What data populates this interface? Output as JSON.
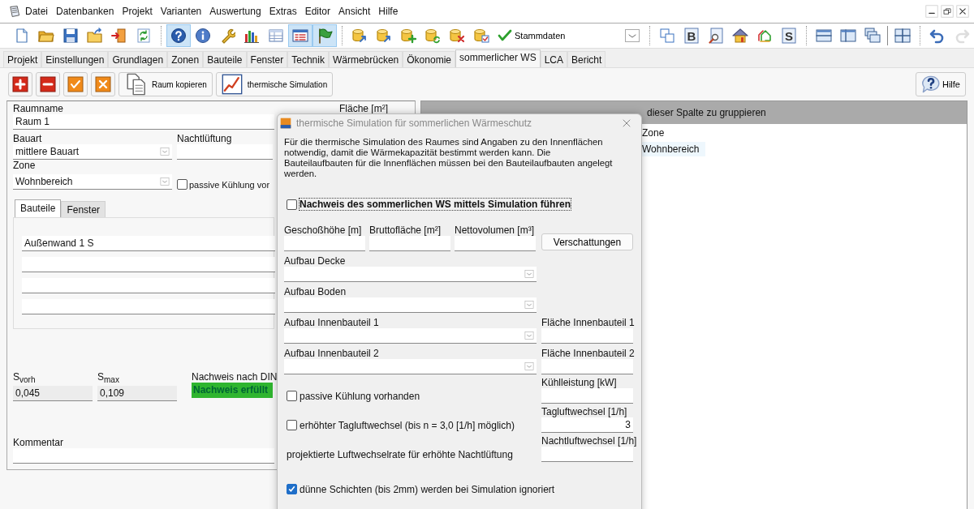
{
  "menu": [
    "Datei",
    "Datenbanken",
    "Projekt",
    "Varianten",
    "Auswertung",
    "Extras",
    "Editor",
    "Ansicht",
    "Hilfe"
  ],
  "toolbar": [
    {
      "pressed": false,
      "disabled": false
    },
    {
      "pressed": false,
      "disabled": false
    },
    {
      "pressed": false,
      "disabled": false
    },
    {
      "pressed": false,
      "disabled": false
    },
    {
      "pressed": false,
      "disabled": false
    },
    {
      "pressed": false,
      "disabled": false
    },
    {
      "pressed": true,
      "disabled": false
    },
    {
      "pressed": false,
      "disabled": false
    },
    {
      "pressed": false,
      "disabled": false
    },
    {
      "pressed": false,
      "disabled": false
    },
    {
      "pressed": false,
      "disabled": false
    },
    {
      "pressed": true,
      "disabled": false
    },
    {
      "pressed": true,
      "disabled": false
    },
    {
      "pressed": false,
      "disabled": false
    },
    {
      "pressed": false,
      "disabled": false
    },
    {
      "pressed": false,
      "disabled": false
    },
    {
      "pressed": false,
      "disabled": false
    },
    {
      "pressed": false,
      "disabled": false
    },
    {
      "pressed": false,
      "disabled": false
    },
    {
      "label": "Stammdaten",
      "pressed": false,
      "disabled": false
    },
    {
      "pressed": false,
      "disabled": false
    },
    {
      "pressed": false,
      "disabled": false
    },
    {
      "glyph": "B",
      "pressed": false,
      "disabled": false
    },
    {
      "pressed": false,
      "disabled": false
    },
    {
      "pressed": false,
      "disabled": false
    },
    {
      "pressed": false,
      "disabled": false
    },
    {
      "glyph": "S",
      "pressed": false,
      "disabled": false
    },
    {
      "pressed": false,
      "disabled": false
    },
    {
      "pressed": false,
      "disabled": false
    },
    {
      "pressed": false,
      "disabled": false
    },
    {
      "pressed": false,
      "disabled": false
    },
    {
      "pressed": false,
      "disabled": false
    },
    {
      "pressed": false,
      "disabled": true
    }
  ],
  "tabs": [
    {
      "label": "Projekt",
      "selected": false
    },
    {
      "label": "Einstellungen",
      "selected": false
    },
    {
      "label": "Grundlagen",
      "selected": false
    },
    {
      "label": "Zonen",
      "selected": false
    },
    {
      "label": "Bauteile",
      "selected": false
    },
    {
      "label": "Fenster",
      "selected": false
    },
    {
      "label": "Technik",
      "selected": false
    },
    {
      "label": "Wärmebrücken",
      "selected": false
    },
    {
      "label": "Ökonomie",
      "selected": false
    },
    {
      "label": "sommerlicher WS",
      "selected": true
    },
    {
      "label": "LCA",
      "selected": false
    },
    {
      "label": "Bericht",
      "selected": false
    }
  ],
  "actions": {
    "copy": "Raum kopieren",
    "simulation": "thermische Simulation",
    "help": "Hilfe"
  },
  "room": {
    "name_label": "Raumname",
    "name": "Raum 1",
    "area_label": "Fläche [m²]",
    "type_label": "Bauart",
    "type": "mittlere Bauart",
    "night_label": "Nachtlüftung",
    "zone_label": "Zone",
    "zone": "Wohnbereich",
    "passive": {
      "label": "passive Kühlung vor",
      "checked": false
    },
    "subtabs": [
      {
        "label": "Bauteile",
        "selected": true
      },
      {
        "label": "Fenster",
        "selected": false
      }
    ],
    "components": [
      "Außenwand 1 S"
    ],
    "s_vorh": {
      "label": "S$_{vorh}$",
      "value": "0,045"
    },
    "s_max": {
      "label": "S$_{max}$",
      "value": "0,109"
    },
    "din_label": "Nachweis nach DIN",
    "din_result": "Nachweis erfüllt",
    "din_passed": true,
    "comment_label": "Kommentar"
  },
  "grid": {
    "group_hint": "dieser Spalte zu gruppieren",
    "column": "Zone",
    "rows": [
      "Wohnbereich"
    ]
  },
  "dialog": {
    "title": "thermische Simulation für sommerlichen Wärmeschutz",
    "intro": "Für die thermische Simulation des Raumes sind Angaben zu den Innenflächen notwendig, damit die Wärmekapazität bestimmt werden kann. Die Bauteilaufbauten für die Innenflächen müssen bei den Bauteilaufbauten angelegt werden.",
    "simulate": {
      "label": "Nachweis des sommerlichen WS mittels Simulation führen",
      "checked": false
    },
    "dims": [
      "Geschoßhöhe [m]",
      "Bruttofläche [m²]",
      "Nettovolumen [m³]"
    ],
    "shading": "Verschattungen",
    "constructions": [
      {
        "label": "Aufbau Decke"
      },
      {
        "label": "Aufbau Boden"
      },
      {
        "label": "Aufbau Innenbauteil 1",
        "area_label": "Fläche Innenbauteil 1"
      },
      {
        "label": "Aufbau Innenbauteil 2",
        "area_label": "Fläche Innenbauteil 2"
      }
    ],
    "options": [
      {
        "kind": "checkbox",
        "label": "passive Kühlung vorhanden",
        "checked": false,
        "field_label": "Kühlleistung [kW]"
      },
      {
        "kind": "checkbox",
        "label": "erhöhter Tagluftwechsel (bis n = 3,0 [1/h] möglich)",
        "checked": false,
        "field_label": "Tagluftwechsel [1/h]",
        "field_value": "3"
      },
      {
        "kind": "text",
        "label": "projektierte Luftwechselrate für erhöhte Nachtlüftung",
        "field_label": "Nachtluftwechsel [1/h]"
      },
      {
        "kind": "checkbox",
        "label": "dünne Schichten (bis 2mm) werden bei Simulation ignoriert",
        "checked": true
      }
    ]
  }
}
